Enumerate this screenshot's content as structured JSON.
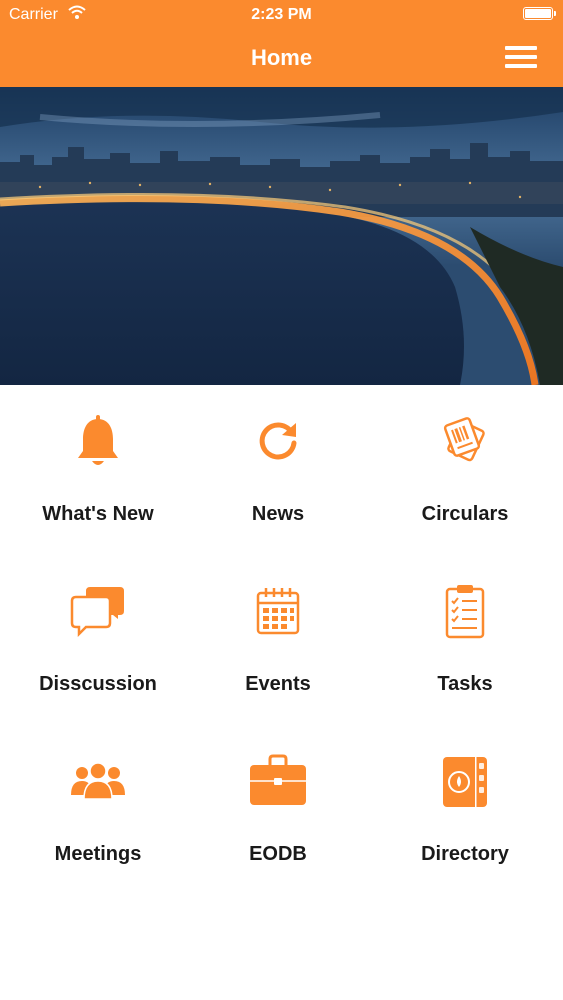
{
  "status_bar": {
    "carrier": "Carrier",
    "time": "2:23 PM"
  },
  "nav": {
    "title": "Home",
    "menu_icon": "hamburger-icon"
  },
  "hero": {
    "icon": "city-skyline-image"
  },
  "colors": {
    "accent": "#fb8a2e",
    "label_text": "#1a1a1a",
    "background": "#ffffff"
  },
  "grid": {
    "items": [
      {
        "label": "What's New",
        "icon": "bell-icon"
      },
      {
        "label": "News",
        "icon": "refresh-icon"
      },
      {
        "label": "Circulars",
        "icon": "circular-cards-icon"
      },
      {
        "label": "Disscussion",
        "icon": "chat-bubbles-icon"
      },
      {
        "label": "Events",
        "icon": "calendar-icon"
      },
      {
        "label": "Tasks",
        "icon": "clipboard-checklist-icon"
      },
      {
        "label": "Meetings",
        "icon": "people-group-icon"
      },
      {
        "label": "EODB",
        "icon": "briefcase-icon"
      },
      {
        "label": "Directory",
        "icon": "directory-book-icon"
      }
    ]
  }
}
